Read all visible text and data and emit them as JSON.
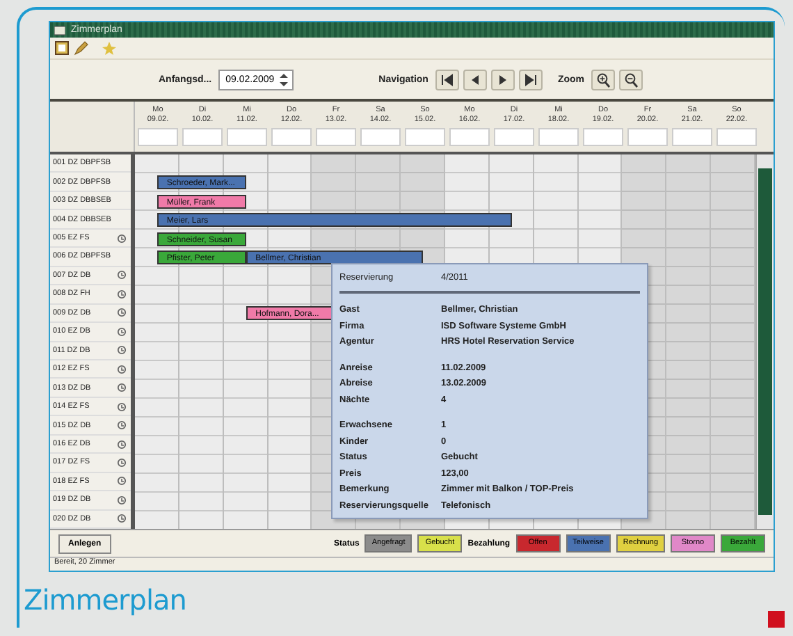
{
  "window": {
    "title": "Zimmerplan"
  },
  "navigation": {
    "start_label": "Anfangsd...",
    "start_date": "09.02.2009",
    "nav_label": "Navigation",
    "zoom_label": "Zoom"
  },
  "days": [
    {
      "weekday": "Mo",
      "date": "09.02.",
      "shaded": false
    },
    {
      "weekday": "Di",
      "date": "10.02.",
      "shaded": false
    },
    {
      "weekday": "Mi",
      "date": "11.02.",
      "shaded": false
    },
    {
      "weekday": "Do",
      "date": "12.02.",
      "shaded": false
    },
    {
      "weekday": "Fr",
      "date": "13.02.",
      "shaded": true
    },
    {
      "weekday": "Sa",
      "date": "14.02.",
      "shaded": true
    },
    {
      "weekday": "So",
      "date": "15.02.",
      "shaded": true
    },
    {
      "weekday": "Mo",
      "date": "16.02.",
      "shaded": false
    },
    {
      "weekday": "Di",
      "date": "17.02.",
      "shaded": false
    },
    {
      "weekday": "Mi",
      "date": "18.02.",
      "shaded": false
    },
    {
      "weekday": "Do",
      "date": "19.02.",
      "shaded": false
    },
    {
      "weekday": "Fr",
      "date": "20.02.",
      "shaded": true
    },
    {
      "weekday": "Sa",
      "date": "21.02.",
      "shaded": true
    },
    {
      "weekday": "So",
      "date": "22.02.",
      "shaded": true
    }
  ],
  "rooms": [
    {
      "name": "001 DZ DBPFSB",
      "flag": false
    },
    {
      "name": "002 DZ DBPFSB",
      "flag": false,
      "slots": [
        {
          "kind": "free"
        },
        {
          "kind": "booking",
          "guest": "Schroeder, Mark...",
          "color": "#4a72b0"
        },
        {
          "kind": "continued"
        },
        {
          "kind": "continued"
        },
        {
          "kind": "continued"
        }
      ]
    },
    {
      "name": "003 DZ DBBSEB",
      "flag": false,
      "slots": [
        {
          "kind": "free"
        },
        {
          "kind": "booking",
          "guest": "Müller, Frank",
          "color": "#f07aa8"
        },
        {
          "kind": "continued"
        },
        {
          "kind": "continued"
        },
        {
          "kind": "continued"
        }
      ]
    },
    {
      "name": "004 DZ DBBSEB",
      "flag": false,
      "slots": [
        {
          "kind": "free"
        },
        {
          "kind": "booking",
          "guest": "Meier, Lars",
          "color": "#4a72b0"
        },
        {
          "kind": "continued"
        },
        {
          "kind": "continued"
        },
        {
          "kind": "continued"
        },
        {
          "kind": "continued"
        },
        {
          "kind": "continued"
        },
        {
          "kind": "continued"
        },
        {
          "kind": "continued"
        },
        {
          "kind": "continued"
        },
        {
          "kind": "continued"
        },
        {
          "kind": "continued"
        },
        {
          "kind": "continued"
        },
        {
          "kind": "continued"
        },
        {
          "kind": "continued"
        },
        {
          "kind": "continued"
        },
        {
          "kind": "continued"
        }
      ]
    },
    {
      "name": "005 EZ FS",
      "flag": true,
      "slots": [
        {
          "kind": "free"
        },
        {
          "kind": "booking",
          "guest": "Schneider, Susan",
          "color": "#3aa83a"
        },
        {
          "kind": "continued"
        },
        {
          "kind": "continued"
        },
        {
          "kind": "continued"
        }
      ]
    },
    {
      "name": "006 DZ DBPFSB",
      "flag": false,
      "slots": [
        {
          "kind": "free"
        },
        {
          "kind": "booking",
          "guest": "Pfister, Peter",
          "color": "#3aa83a"
        },
        {
          "kind": "continued"
        },
        {
          "kind": "continued"
        },
        {
          "kind": "continued"
        },
        {
          "kind": "booking",
          "guest": "Bellmer, Christian",
          "color": "#4a72b0"
        },
        {
          "kind": "continued"
        },
        {
          "kind": "continued"
        },
        {
          "kind": "continued"
        },
        {
          "kind": "continued"
        },
        {
          "kind": "continued"
        },
        {
          "kind": "continued"
        },
        {
          "kind": "continued"
        }
      ]
    },
    {
      "name": "007 DZ DB",
      "flag": true
    },
    {
      "name": "008 DZ FH",
      "flag": true
    },
    {
      "name": "009 DZ DB",
      "flag": true,
      "slots": [
        {
          "kind": "free"
        },
        {
          "kind": "free"
        },
        {
          "kind": "free"
        },
        {
          "kind": "free"
        },
        {
          "kind": "free"
        },
        {
          "kind": "booking",
          "guest": "Hofmann, Dora...",
          "color": "#f07aa8"
        },
        {
          "kind": "continued"
        },
        {
          "kind": "continued"
        },
        {
          "kind": "continued"
        }
      ]
    },
    {
      "name": "010 EZ DB",
      "flag": true
    },
    {
      "name": "011 DZ DB",
      "flag": true
    },
    {
      "name": "012 EZ FS",
      "flag": true
    },
    {
      "name": "013 DZ DB",
      "flag": true
    },
    {
      "name": "014 EZ FS",
      "flag": true
    },
    {
      "name": "015 DZ DB",
      "flag": true
    },
    {
      "name": "016 EZ DB",
      "flag": true
    },
    {
      "name": "017 DZ FS",
      "flag": true
    },
    {
      "name": "018 EZ FS",
      "flag": true
    },
    {
      "name": "019 DZ DB",
      "flag": true
    },
    {
      "name": "020 DZ DB",
      "flag": true
    }
  ],
  "tooltip": {
    "header_label": "Reservierung",
    "header_value": "4/2011",
    "groups": [
      [
        {
          "label": "Gast",
          "value": "Bellmer, Christian"
        },
        {
          "label": "Firma",
          "value": "ISD Software Systeme GmbH"
        },
        {
          "label": "Agentur",
          "value": "HRS Hotel Reservation Service"
        }
      ],
      [
        {
          "label": "Anreise",
          "value": "11.02.2009"
        },
        {
          "label": "Abreise",
          "value": "13.02.2009"
        },
        {
          "label": "Nächte",
          "value": "4"
        }
      ],
      [
        {
          "label": "Erwachsene",
          "value": "1"
        },
        {
          "label": "Kinder",
          "value": "0"
        },
        {
          "label": "Status",
          "value": "Gebucht"
        },
        {
          "label": "Preis",
          "value": "123,00"
        },
        {
          "label": "Bemerkung",
          "value": "Zimmer mit Balkon / TOP-Preis"
        },
        {
          "label": "Reservierungsquelle",
          "value": "Telefonisch"
        }
      ]
    ]
  },
  "footer": {
    "add_button": "Anlegen",
    "status_label": "Status",
    "statuses": [
      {
        "label": "Angefragt",
        "color": "#8c8c8c"
      },
      {
        "label": "Gebucht",
        "color": "#d8e04a"
      }
    ],
    "payment_label": "Bezahlung",
    "payments": [
      {
        "label": "Offen",
        "color": "#c8282e"
      },
      {
        "label": "Teilweise",
        "color": "#4a72b0"
      },
      {
        "label": "Rechnung",
        "color": "#e0d040"
      },
      {
        "label": "Storno",
        "color": "#e088c8"
      },
      {
        "label": "Bezahlt",
        "color": "#3aa83a"
      }
    ]
  },
  "status_bar": "Bereit, 20 Zimmer",
  "caption": "Zimmerplan"
}
